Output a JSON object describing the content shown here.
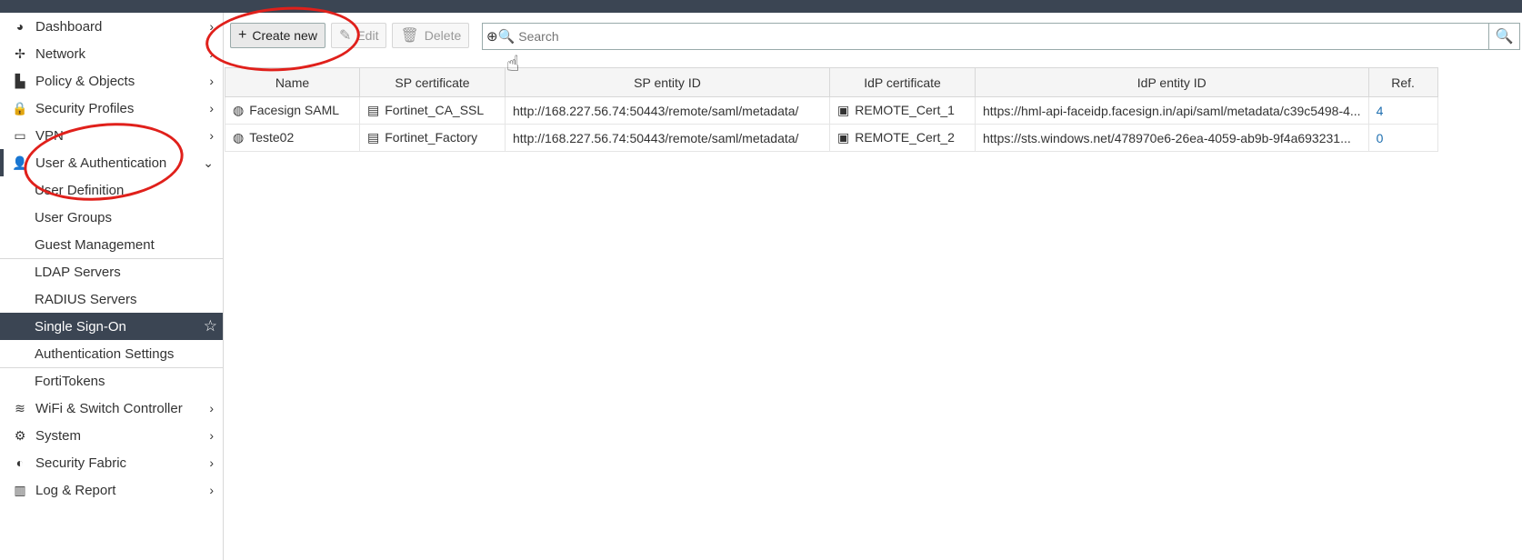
{
  "sidebar": {
    "items": [
      {
        "icon": "dashboard-icon",
        "glyph": "◕",
        "label": "Dashboard",
        "chevron": "›"
      },
      {
        "icon": "network-icon",
        "glyph": "✢",
        "label": "Network",
        "chevron": "›"
      },
      {
        "icon": "policy-icon",
        "glyph": "▙",
        "label": "Policy & Objects",
        "chevron": "›"
      },
      {
        "icon": "lock-icon",
        "glyph": "🔒",
        "label": "Security Profiles",
        "chevron": "›"
      },
      {
        "icon": "laptop-icon",
        "glyph": "▭",
        "label": "VPN",
        "chevron": "›"
      },
      {
        "icon": "user-icon",
        "glyph": "👤",
        "label": "User & Authentication",
        "chevron": "⌄"
      }
    ],
    "sub_items": [
      "User Definition",
      "User Groups",
      "Guest Management",
      "LDAP Servers",
      "RADIUS Servers",
      "Single Sign-On",
      "Authentication Settings",
      "FortiTokens"
    ],
    "star": "☆",
    "items_after": [
      {
        "icon": "wifi-icon",
        "glyph": "≋",
        "label": "WiFi & Switch Controller",
        "chevron": "›"
      },
      {
        "icon": "gear-icon",
        "glyph": "⚙",
        "label": "System",
        "chevron": "›"
      },
      {
        "icon": "fabric-icon",
        "glyph": "◐",
        "label": "Security Fabric",
        "chevron": "›"
      },
      {
        "icon": "chart-icon",
        "glyph": "▥",
        "label": "Log & Report",
        "chevron": "›"
      }
    ]
  },
  "toolbar": {
    "create_label": "Create new",
    "create_glyph": "+",
    "edit_label": "Edit",
    "edit_glyph": "✎",
    "delete_label": "Delete",
    "delete_glyph": "🗑",
    "search_placeholder": "Search",
    "search_glyph": "⊕🔍",
    "search_btn_glyph": "🔍"
  },
  "table": {
    "columns": [
      "Name",
      "SP certificate",
      "SP entity ID",
      "IdP certificate",
      "IdP entity ID",
      "Ref."
    ],
    "rows": [
      {
        "name": "Facesign SAML",
        "sp_cert": "Fortinet_CA_SSL",
        "sp_entity": "http://168.227.56.74:50443/remote/saml/metadata/",
        "idp_cert": "REMOTE_Cert_1",
        "idp_entity": "https://hml-api-faceidp.facesign.in/api/saml/metadata/c39c5498-4...",
        "ref": "4"
      },
      {
        "name": "Teste02",
        "sp_cert": "Fortinet_Factory",
        "sp_entity": "http://168.227.56.74:50443/remote/saml/metadata/",
        "idp_cert": "REMOTE_Cert_2",
        "idp_entity": "https://sts.windows.net/478970e6-26ea-4059-ab9b-9f4a693231...",
        "ref": "0"
      }
    ]
  },
  "annotation_color": "#e0201b"
}
